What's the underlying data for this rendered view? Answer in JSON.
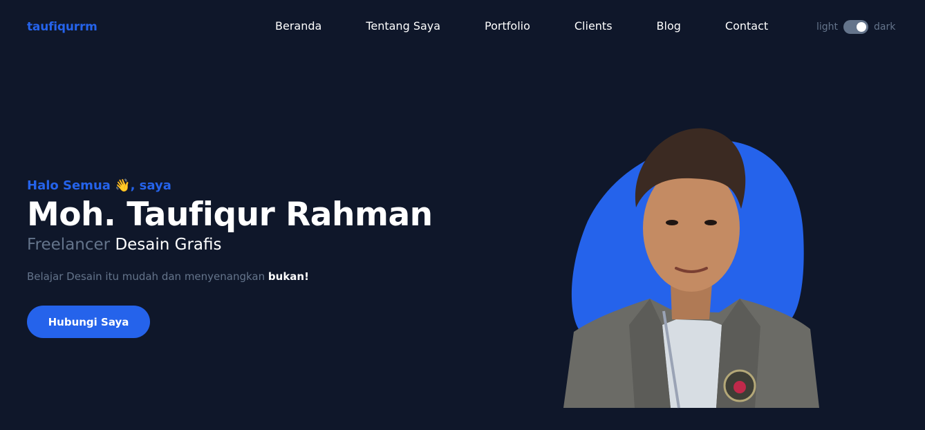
{
  "header": {
    "brand": "taufiqurrm",
    "nav": [
      {
        "label": "Beranda"
      },
      {
        "label": "Tentang Saya"
      },
      {
        "label": "Portfolio"
      },
      {
        "label": "Clients"
      },
      {
        "label": "Blog"
      },
      {
        "label": "Contact"
      }
    ],
    "theme_toggle": {
      "light_label": "light",
      "dark_label": "dark",
      "state": "dark"
    }
  },
  "hero": {
    "greeting": "Halo Semua 👋, saya",
    "name": "Moh. Taufiqur Rahman",
    "role_muted": "Freelancer",
    "role_strong": "Desain Grafis",
    "tagline_text": "Belajar Desain itu mudah dan menyenangkan",
    "tagline_bold": "bukan!",
    "cta_label": "Hubungi Saya"
  },
  "colors": {
    "background": "#0f172a",
    "accent": "#2563eb",
    "muted": "#64748b",
    "text": "#ffffff"
  }
}
